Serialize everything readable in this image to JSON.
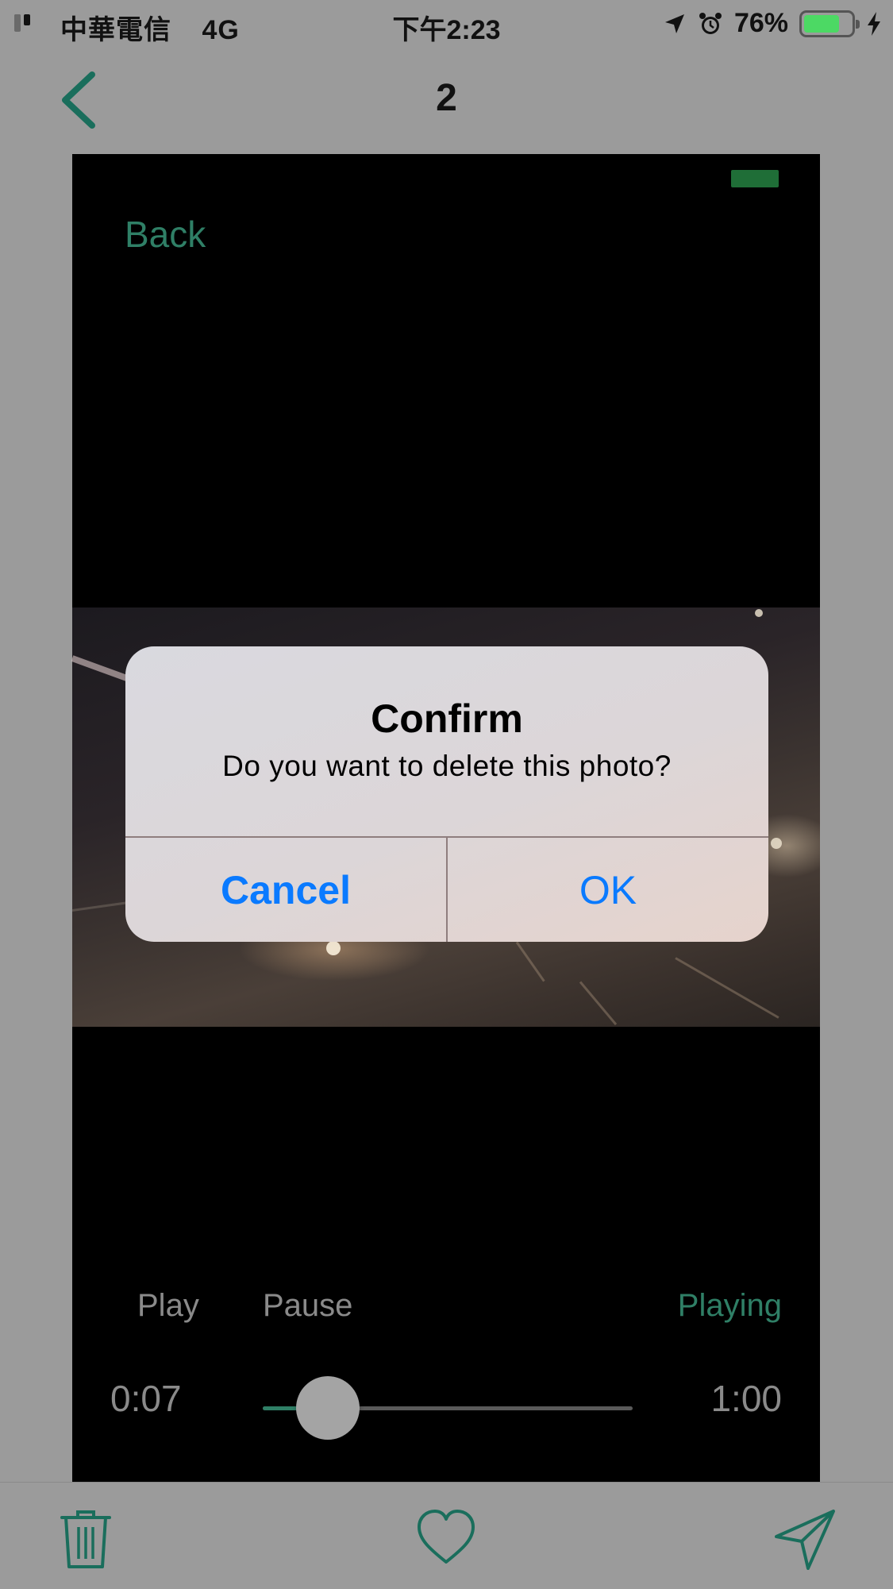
{
  "status_bar": {
    "carrier": "中華電信",
    "network": "4G",
    "time": "下午2:23",
    "battery_percent": "76%",
    "battery_level": 0.76,
    "battery_color": "#4cd964"
  },
  "nav": {
    "title": "2",
    "back_icon": "chevron-left-icon"
  },
  "player": {
    "back_label": "Back",
    "play_label": "Play",
    "pause_label": "Pause",
    "state_label": "Playing",
    "current_time": "0:07",
    "total_time": "1:00",
    "progress": 0.117,
    "accent_color": "#2f7f66"
  },
  "alert": {
    "title": "Confirm",
    "message": "Do you want to delete this photo?",
    "cancel_label": "Cancel",
    "ok_label": "OK",
    "button_color": "#0a7aff"
  },
  "toolbar": {
    "icons": [
      "trash-icon",
      "heart-icon",
      "send-icon"
    ]
  }
}
